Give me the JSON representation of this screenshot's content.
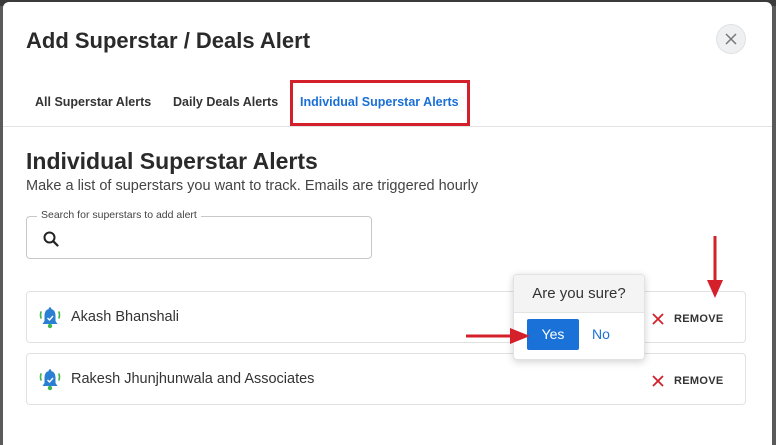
{
  "modal": {
    "title": "Add Superstar / Deals Alert"
  },
  "tabs": [
    {
      "label": "All Superstar Alerts",
      "active": false
    },
    {
      "label": "Daily Deals Alerts",
      "active": false
    },
    {
      "label": "Individual Superstar Alerts",
      "active": true
    }
  ],
  "section": {
    "title": "Individual Superstar Alerts",
    "subtitle": "Make a list of superstars you want to track. Emails are triggered hourly"
  },
  "search": {
    "label": "Search for superstars to add alert",
    "value": "",
    "icon": "search-icon"
  },
  "alerts": [
    {
      "name": "Akash Bhanshali",
      "remove_label": "REMOVE",
      "icon": "bell-icon"
    },
    {
      "name": "Rakesh Jhunjhunwala and Associates",
      "remove_label": "REMOVE",
      "icon": "bell-icon"
    }
  ],
  "confirm": {
    "title": "Are you sure?",
    "yes_label": "Yes",
    "no_label": "No"
  },
  "colors": {
    "accent": "#1a72d8",
    "annotation_red": "#d4202a",
    "bell_blue": "#2a7fd4",
    "bell_green": "#3fb54a"
  }
}
